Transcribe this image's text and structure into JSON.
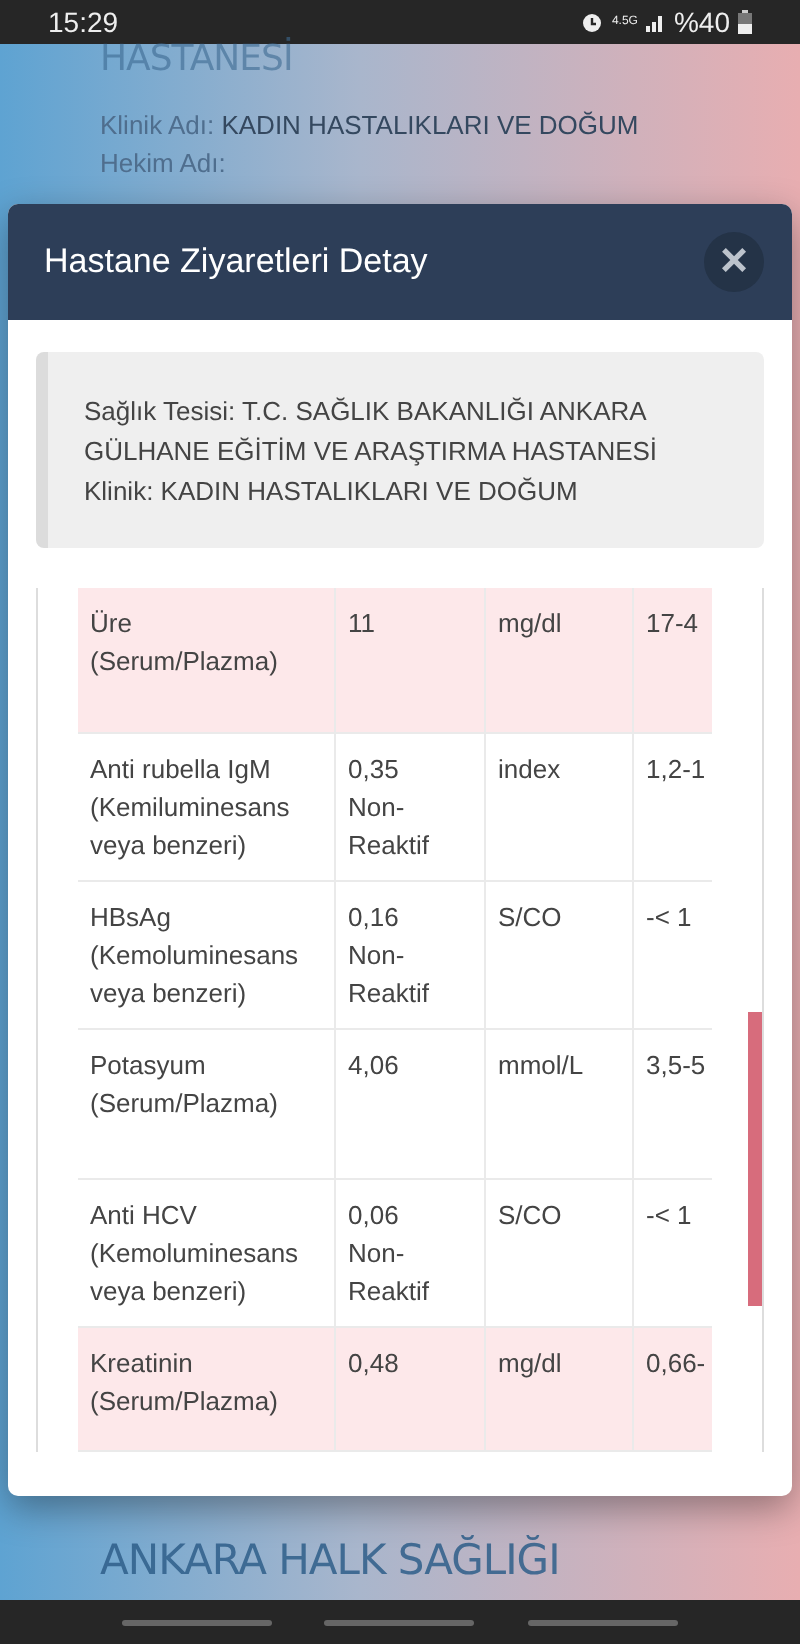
{
  "status_bar": {
    "time": "15:29",
    "network": "4.5G",
    "battery": "%40"
  },
  "background_page": {
    "heading_top": "HASTANESİ",
    "fields": [
      {
        "label": "Klinik Adı:",
        "value": "KADIN HASTALIKLARI VE DOĞUM"
      },
      {
        "label": "Hekim Adı:"
      }
    ],
    "heading_bottom": "ANKARA HALK SAĞLIĞI"
  },
  "modal": {
    "title": "Hastane Ziyaretleri Detay",
    "close": "×",
    "info": [
      "Sağlık Tesisi: T.C. SAĞLIK BAKANLIĞI ANKARA GÜLHANE EĞİTİM VE ARAŞTIRMA HASTANESİ",
      "Klinik: KADIN HASTALIKLARI VE DOĞUM"
    ],
    "rows": [
      {
        "test": "Üre (Serum/Plazma)",
        "result": "11",
        "unit": "mg/dl",
        "reference": "17-4",
        "abnormal": true
      },
      {
        "test": "Anti rubella IgM (Kemiluminesans veya benzeri)",
        "result": "0,35 Non-Reaktif",
        "unit": "index",
        "reference": "1,2-1",
        "abnormal": false
      },
      {
        "test": "HBsAg (Kemoluminesans veya benzeri)",
        "result": "0,16 Non-Reaktif",
        "unit": "S/CO",
        "reference": "-< 1",
        "abnormal": false
      },
      {
        "test": "Potasyum (Serum/Plazma)",
        "result": "4,06",
        "unit": "mmol/L",
        "reference": "3,5-5",
        "abnormal": false
      },
      {
        "test": "Anti HCV (Kemoluminesans veya benzeri)",
        "result": "0,06 Non-Reaktif",
        "unit": "S/CO",
        "reference": "-< 1",
        "abnormal": false
      },
      {
        "test": "Kreatinin (Serum/Plazma)",
        "result": "0,48",
        "unit": "mg/dl",
        "reference": "0,66-",
        "abnormal": true
      }
    ]
  }
}
